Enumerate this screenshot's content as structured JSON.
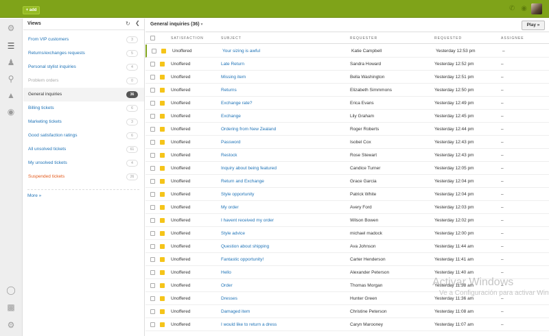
{
  "topbar": {
    "new_label": "+ add",
    "icons": [
      "phone-icon",
      "eye-icon"
    ]
  },
  "iconbar": {
    "icons": [
      "gear-icon",
      "menu-icon",
      "users-icon",
      "search-icon",
      "reporting-icon",
      "apps-icon",
      "zendesk-icon",
      "chart-icon",
      "admin-gear-icon"
    ]
  },
  "views": {
    "title": "Views",
    "items": [
      {
        "label": "From VIP customers",
        "count": "3"
      },
      {
        "label": "Returns/exchanges requests",
        "count": "5"
      },
      {
        "label": "Personal stylist inquiries",
        "count": "4"
      },
      {
        "label": "Problem orders",
        "count": "0"
      },
      {
        "label": "General inquiries",
        "count": "36"
      },
      {
        "label": "Billing tickets",
        "count": "6"
      },
      {
        "label": "Marketing tickets",
        "count": "3"
      },
      {
        "label": "Good satisfaction ratings",
        "count": "6"
      },
      {
        "label": "All unsolved tickets",
        "count": "61"
      },
      {
        "label": "My unsolved tickets",
        "count": "4"
      },
      {
        "label": "Suspended tickets",
        "count": "26"
      }
    ],
    "more": "More »"
  },
  "main": {
    "title": "General inquiries (36)",
    "play": "Play »",
    "columns": {
      "satisfaction": "SATISFACTION",
      "subject": "SUBJECT",
      "requester": "REQUESTER",
      "requested": "REQUESTED",
      "assignee": "ASSIGNEE"
    },
    "rows": [
      {
        "satisfaction": "Unoffered",
        "subject": "Your sizing is awful",
        "requester": "Katie Campbell",
        "requested": "Yesterday 12:53 pm",
        "assignee": "–"
      },
      {
        "satisfaction": "Unoffered",
        "subject": "Late Return",
        "requester": "Sandra Howard",
        "requested": "Yesterday 12:52 pm",
        "assignee": "–"
      },
      {
        "satisfaction": "Unoffered",
        "subject": "Missing item",
        "requester": "Bella Washington",
        "requested": "Yesterday 12:51 pm",
        "assignee": "–"
      },
      {
        "satisfaction": "Unoffered",
        "subject": "Returns",
        "requester": "Elizabeth Simmmons",
        "requested": "Yesterday 12:50 pm",
        "assignee": "–"
      },
      {
        "satisfaction": "Unoffered",
        "subject": "Exchange rate?",
        "requester": "Erica Evans",
        "requested": "Yesterday 12:49 pm",
        "assignee": "–"
      },
      {
        "satisfaction": "Unoffered",
        "subject": "Exchange",
        "requester": "Lily Graham",
        "requested": "Yesterday 12:45 pm",
        "assignee": "–"
      },
      {
        "satisfaction": "Unoffered",
        "subject": "Ordering from New Zealand",
        "requester": "Roger Roberts",
        "requested": "Yesterday 12:44 pm",
        "assignee": "–"
      },
      {
        "satisfaction": "Unoffered",
        "subject": "Password",
        "requester": "Isobel Cox",
        "requested": "Yesterday 12:43 pm",
        "assignee": "–"
      },
      {
        "satisfaction": "Unoffered",
        "subject": "Restock",
        "requester": "Rose Stewart",
        "requested": "Yesterday 12:43 pm",
        "assignee": "–"
      },
      {
        "satisfaction": "Unoffered",
        "subject": "Inquiry about being featured",
        "requester": "Candice Turner",
        "requested": "Yesterday 12:05 pm",
        "assignee": "–"
      },
      {
        "satisfaction": "Unoffered",
        "subject": "Return and Exchange",
        "requester": "Grace Garcia",
        "requested": "Yesterday 12:04 pm",
        "assignee": "–"
      },
      {
        "satisfaction": "Unoffered",
        "subject": "Style opportunity",
        "requester": "Patrick White",
        "requested": "Yesterday 12:04 pm",
        "assignee": "–"
      },
      {
        "satisfaction": "Unoffered",
        "subject": "My order",
        "requester": "Avery Ford",
        "requested": "Yesterday 12:03 pm",
        "assignee": "–"
      },
      {
        "satisfaction": "Unoffered",
        "subject": "I havent received my order",
        "requester": "Wilson Bowen",
        "requested": "Yesterday 12:02 pm",
        "assignee": "–"
      },
      {
        "satisfaction": "Unoffered",
        "subject": "Style advice",
        "requester": "michael madock",
        "requested": "Yesterday 12:00 pm",
        "assignee": "–"
      },
      {
        "satisfaction": "Unoffered",
        "subject": "Question about shipping",
        "requester": "Ava Johnson",
        "requested": "Yesterday 11:44 am",
        "assignee": "–"
      },
      {
        "satisfaction": "Unoffered",
        "subject": "Fantastic opportunity!",
        "requester": "Carter Henderson",
        "requested": "Yesterday 11:41 am",
        "assignee": "–"
      },
      {
        "satisfaction": "Unoffered",
        "subject": "Hello",
        "requester": "Alexander Peterson",
        "requested": "Yesterday 11:40 am",
        "assignee": "–"
      },
      {
        "satisfaction": "Unoffered",
        "subject": "Order",
        "requester": "Thomas Morgan",
        "requested": "Yesterday 11:38 am",
        "assignee": "–"
      },
      {
        "satisfaction": "Unoffered",
        "subject": "Dresses",
        "requester": "Hunter Green",
        "requested": "Yesterday 11:36 am",
        "assignee": "–"
      },
      {
        "satisfaction": "Unoffered",
        "subject": "Damaged item",
        "requester": "Christine Peterson",
        "requested": "Yesterday 11:08 am",
        "assignee": "–"
      },
      {
        "satisfaction": "Unoffered",
        "subject": "I would like to return a dress",
        "requester": "Caryn Marooney",
        "requested": "Yesterday 11:07 am",
        "assignee": "–"
      }
    ]
  },
  "watermark": {
    "title": "Activar Windows",
    "subtitle": "Ve a Configuración para activar Windows."
  },
  "colors": {
    "topbar": "#7fa319",
    "link": "#1f73b7",
    "tag": "#f5c419",
    "suspended": "#e35b1d"
  }
}
